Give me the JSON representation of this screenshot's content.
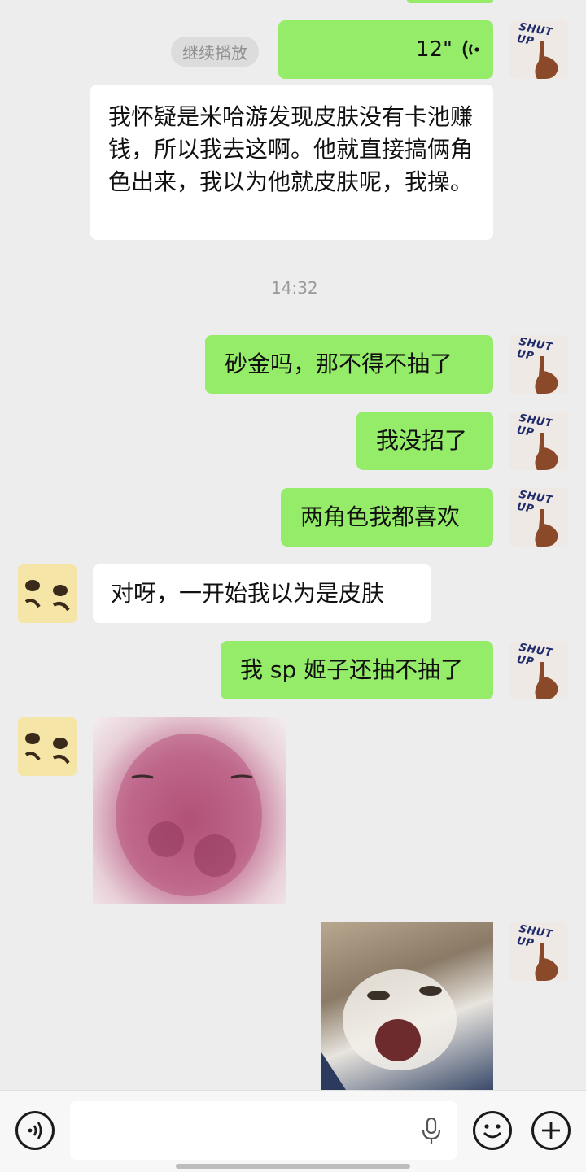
{
  "chat": {
    "voice": {
      "label": "继续播放",
      "duration": "12\""
    },
    "msg_long": "我怀疑是米哈游发现皮肤没有卡池赚钱，所以我去这啊。他就直接搞俩角色出来，我以为他就皮肤呢，我操。",
    "timestamp": "14:32",
    "msg_1": "砂金吗，那不得不抽了",
    "msg_2": "我没招了",
    "msg_3": "两角色我都喜欢",
    "msg_4": "对呀，一开始我以为是皮肤",
    "msg_5": "我 sp 姬子还抽不抽了"
  },
  "avatar_text": "SHUT UP",
  "icons": [
    "voice-input-icon",
    "microphone-icon",
    "emoji-icon",
    "plus-icon",
    "voice-wave-icon"
  ],
  "colors": {
    "sent_bubble": "#95ec69",
    "received_bubble": "#ffffff",
    "background": "#ededed"
  }
}
